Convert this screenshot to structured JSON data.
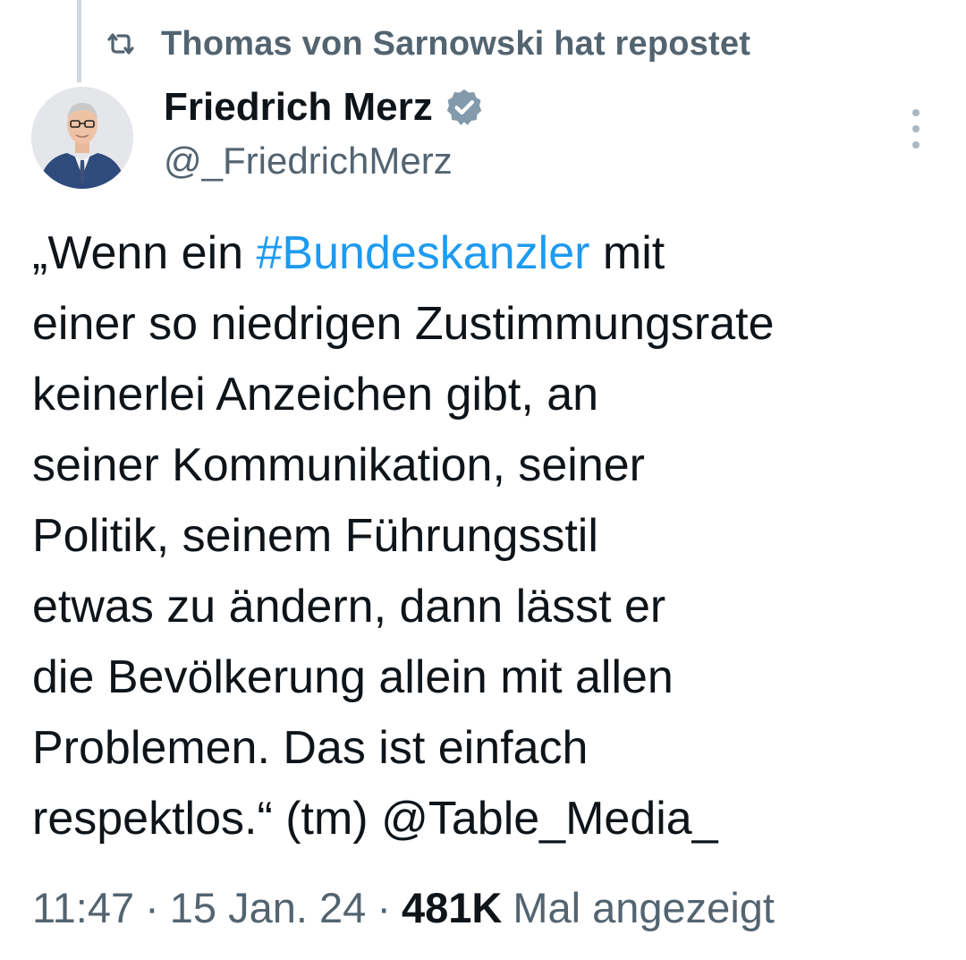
{
  "repost": {
    "icon": "repost-icon",
    "text": "Thomas von Sarnowski hat repostet"
  },
  "author": {
    "name": "Friedrich Merz",
    "handle": "@_FriedrichMerz",
    "verified_icon": "verified-badge-icon",
    "avatar": "avatar-photo"
  },
  "more_icon": "more-options-icon",
  "tweet": {
    "segments": [
      {
        "text": "„Wenn ein "
      },
      {
        "text": "#Bundeskanzler",
        "link": true
      },
      {
        "text": " mit"
      },
      {
        "text": "einer so niedrigen Zustimmungsrate"
      },
      {
        "text": "keinerlei Anzeichen gibt, an"
      },
      {
        "text": "seiner Kommunikation, seiner"
      },
      {
        "text": "Politik, seinem Führungsstil"
      },
      {
        "text": "etwas zu ändern, dann lässt er"
      },
      {
        "text": "die Bevölkerung allein mit allen"
      },
      {
        "text": "Problemen. Das ist einfach"
      },
      {
        "text": "respektlos.“ (tm) "
      },
      {
        "text": "@Table_Media_",
        "link": true
      }
    ]
  },
  "meta": {
    "time": "11:47",
    "separator": "·",
    "date": "15 Jan. 24",
    "views": "481K",
    "views_label": "Mal angezeigt"
  },
  "colors": {
    "text": "#0f1419",
    "secondary": "#536471",
    "link": "#1d9bf0",
    "thread_line": "#cfd9de",
    "background": "#ffffff"
  }
}
